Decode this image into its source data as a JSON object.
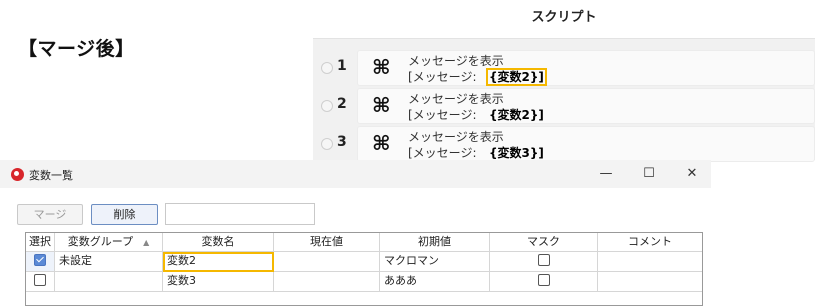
{
  "heading": "【マージ後】",
  "script": {
    "header": "スクリプト",
    "rows": [
      {
        "num": "1",
        "title": "メッセージを表示",
        "param_prefix": "[メッセージ:",
        "open": "{",
        "var": "変数2",
        "close": "}]"
      },
      {
        "num": "2",
        "title": "メッセージを表示",
        "param_prefix": "[メッセージ:",
        "open": "{",
        "var": "変数2",
        "close": "}]"
      },
      {
        "num": "3",
        "title": "メッセージを表示",
        "param_prefix": "[メッセージ:",
        "open": "{",
        "var": "変数3",
        "close": "}]"
      }
    ],
    "command_icon": "⌘"
  },
  "window": {
    "title": "変数一覧",
    "controls": {
      "minimize": "—",
      "maximize": "☐",
      "close": "✕"
    },
    "toolbar": {
      "merge_label": "マージ",
      "delete_label": "削除",
      "search_value": ""
    },
    "table": {
      "columns": [
        "選択",
        "変数グループ",
        "変数名",
        "現在値",
        "初期値",
        "マスク",
        "コメント"
      ],
      "sort_indicator": "▲",
      "rows": [
        {
          "selected": true,
          "group": "未設定",
          "name": "変数2",
          "current": "",
          "initial": "マクロマン",
          "mask": false,
          "comment": ""
        },
        {
          "selected": false,
          "group": "",
          "name": "変数3",
          "current": "",
          "initial": "あああ",
          "mask": false,
          "comment": ""
        }
      ]
    }
  },
  "colors": {
    "highlight": "#f5b800",
    "app_icon": "#d8262b",
    "checked": "#5b8ad6"
  }
}
